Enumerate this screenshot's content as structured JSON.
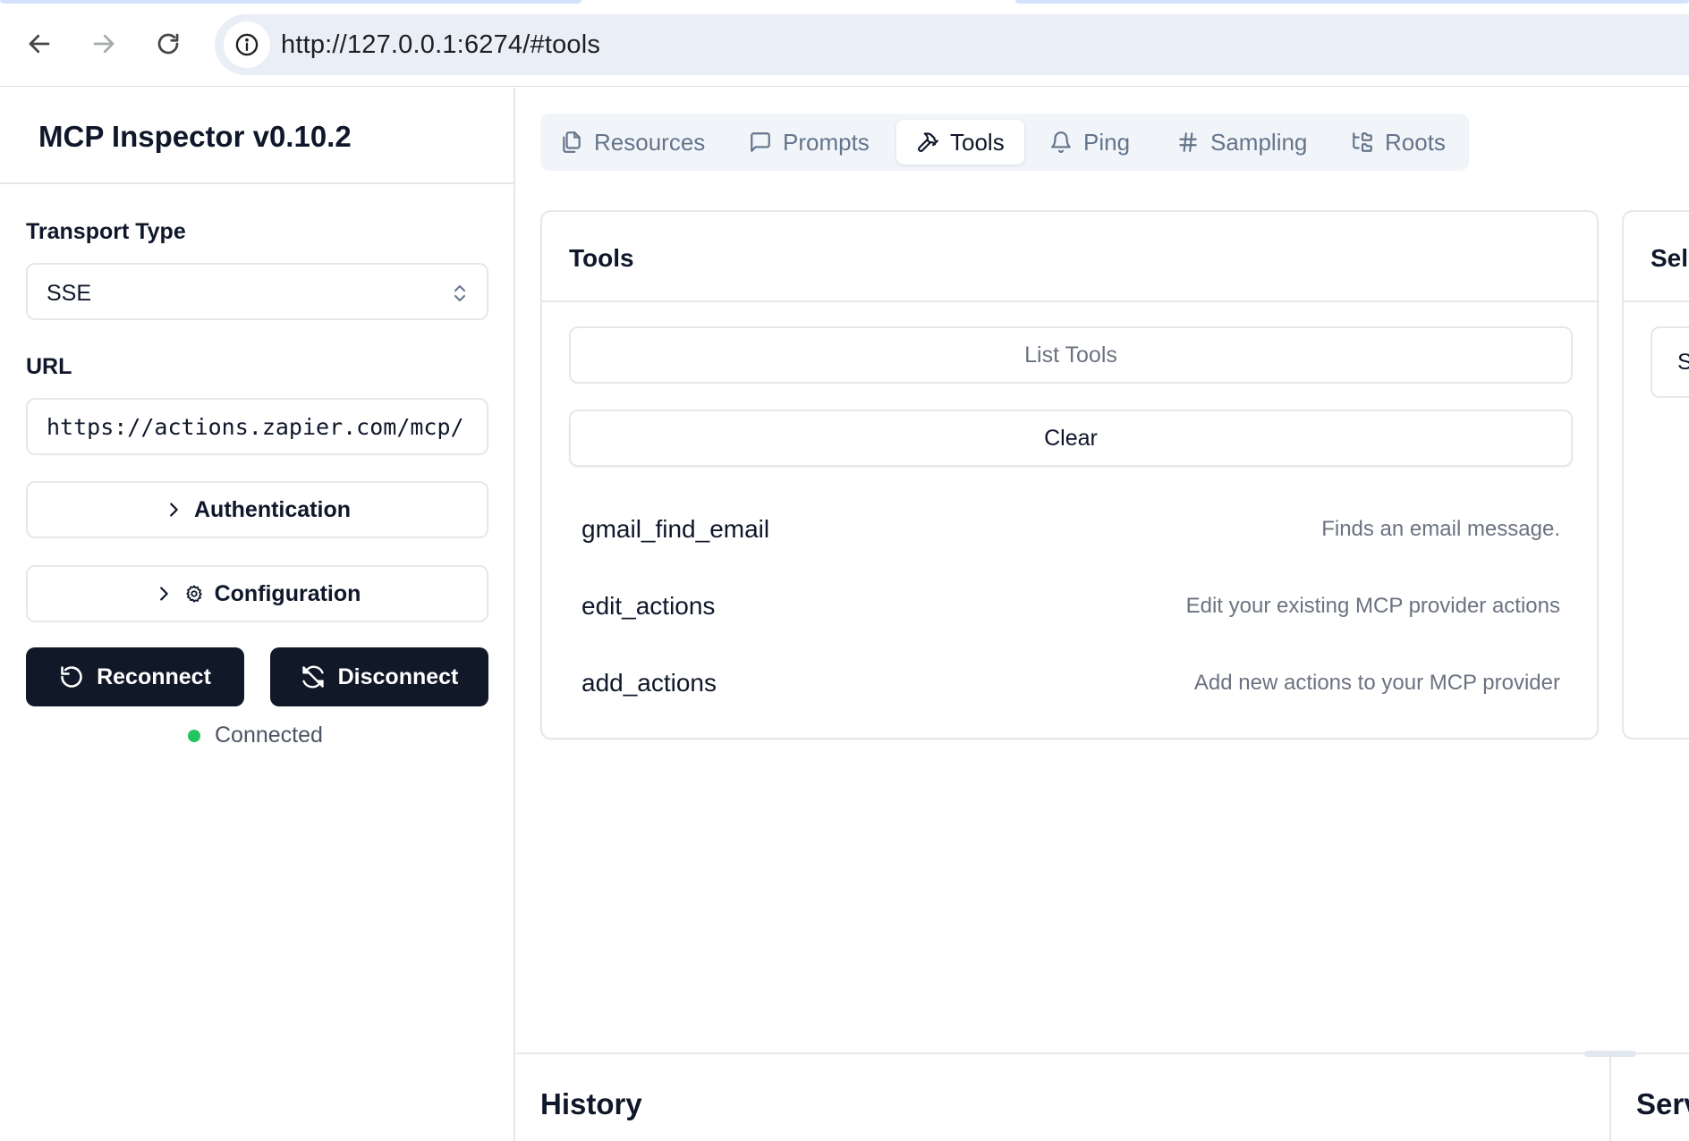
{
  "browser": {
    "url": "http://127.0.0.1:6274/#tools"
  },
  "sidebar": {
    "app_title": "MCP Inspector v0.10.2",
    "transport_label": "Transport Type",
    "transport_value": "SSE",
    "url_label": "URL",
    "url_value": "https://actions.zapier.com/mcp/",
    "authentication_label": "Authentication",
    "configuration_label": "Configuration",
    "reconnect_label": "Reconnect",
    "disconnect_label": "Disconnect",
    "status_text": "Connected",
    "status_color": "#22c55e"
  },
  "tabs": [
    {
      "label": "Resources",
      "icon": "files-icon"
    },
    {
      "label": "Prompts",
      "icon": "message-square-icon"
    },
    {
      "label": "Tools",
      "icon": "hammer-icon",
      "active": true
    },
    {
      "label": "Ping",
      "icon": "bell-icon"
    },
    {
      "label": "Sampling",
      "icon": "hash-icon"
    },
    {
      "label": "Roots",
      "icon": "folder-tree-icon"
    }
  ],
  "tools_panel": {
    "title": "Tools",
    "list_button": "List Tools",
    "clear_button": "Clear",
    "items": [
      {
        "name": "gmail_find_email",
        "description": "Finds an email message."
      },
      {
        "name": "edit_actions",
        "description": "Edit your existing MCP provider actions"
      },
      {
        "name": "add_actions",
        "description": "Add new actions to your MCP provider"
      }
    ]
  },
  "select_panel": {
    "title": "Sel",
    "input_text": "S"
  },
  "history": {
    "title": "History"
  },
  "server_panel": {
    "title": "Serv"
  },
  "colors": {
    "primary_dark": "#111827",
    "border": "#e5e7eb",
    "muted_text": "#6b7280"
  }
}
